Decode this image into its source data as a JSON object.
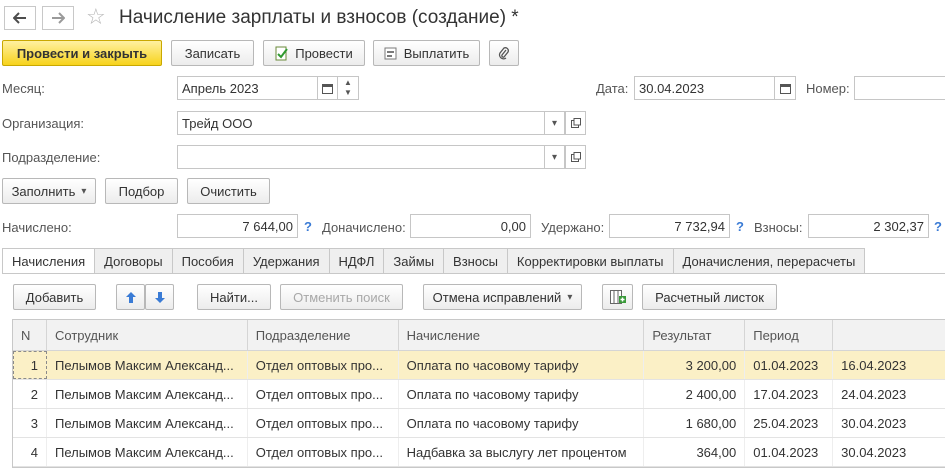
{
  "window": {
    "title": "Начисление зарплаты и взносов (создание) *",
    "back_icon": "arrow-left-icon",
    "forward_icon": "arrow-right-icon",
    "favorite_icon": "star-icon"
  },
  "toolbar": {
    "post_and_close": "Провести и закрыть",
    "save": "Записать",
    "post": "Провести",
    "pay": "Выплатить",
    "attach_icon": "paperclip-icon",
    "primary_color": "#f7d31c"
  },
  "header": {
    "month_label": "Месяц:",
    "month_value": "Апрель 2023",
    "date_label": "Дата:",
    "date_value": "30.04.2023",
    "number_label": "Номер:",
    "number_value": "",
    "org_label": "Организация:",
    "org_value": "Трейд ООО",
    "dept_label": "Подразделение:",
    "dept_value": ""
  },
  "actions": {
    "fill": "Заполнить",
    "select": "Подбор",
    "clear": "Очистить"
  },
  "totals": {
    "accrued_label": "Начислено:",
    "accrued_value": "7 644,00",
    "additional_label": "Доначислено:",
    "additional_value": "0,00",
    "withheld_label": "Удержано:",
    "withheld_value": "7 732,94",
    "contrib_label": "Взносы:",
    "contrib_value": "2 302,37",
    "help": "?"
  },
  "tabs": [
    {
      "label": "Начисления",
      "active": true
    },
    {
      "label": "Договоры"
    },
    {
      "label": "Пособия"
    },
    {
      "label": "Удержания"
    },
    {
      "label": "НДФЛ"
    },
    {
      "label": "Займы"
    },
    {
      "label": "Взносы"
    },
    {
      "label": "Корректировки выплаты"
    },
    {
      "label": "Доначисления, перерасчеты"
    }
  ],
  "grid_toolbar": {
    "add": "Добавить",
    "up_icon": "arrow-up-icon",
    "down_icon": "arrow-down-icon",
    "find": "Найти...",
    "cancel_search": "Отменить поиск",
    "cancel_corrections": "Отмена исправлений",
    "table_icon": "add-column-icon",
    "payslip": "Расчетный листок"
  },
  "table": {
    "columns": [
      "N",
      "Сотрудник",
      "Подразделение",
      "Начисление",
      "Результат",
      "Период",
      ""
    ],
    "rows": [
      {
        "n": "1",
        "employee": "Пелымов Максим Александ...",
        "dept": "Отдел оптовых про...",
        "accrual": "Оплата по часовому тарифу",
        "result": "3 200,00",
        "from": "01.04.2023",
        "to": "16.04.2023",
        "selected": true
      },
      {
        "n": "2",
        "employee": "Пелымов Максим Александ...",
        "dept": "Отдел оптовых про...",
        "accrual": "Оплата по часовому тарифу",
        "result": "2 400,00",
        "from": "17.04.2023",
        "to": "24.04.2023"
      },
      {
        "n": "3",
        "employee": "Пелымов Максим Александ...",
        "dept": "Отдел оптовых про...",
        "accrual": "Оплата по часовому тарифу",
        "result": "1 680,00",
        "from": "25.04.2023",
        "to": "30.04.2023"
      },
      {
        "n": "4",
        "employee": "Пелымов Максим Александ...",
        "dept": "Отдел оптовых про...",
        "accrual": "Надбавка за выслугу лет процентом",
        "result": "364,00",
        "from": "01.04.2023",
        "to": "30.04.2023"
      }
    ]
  }
}
